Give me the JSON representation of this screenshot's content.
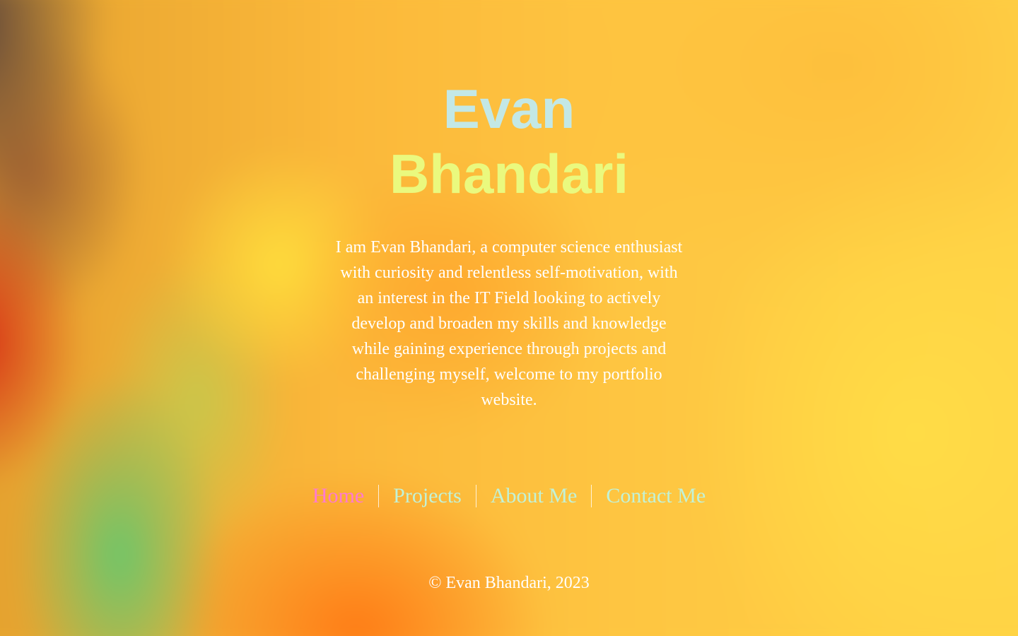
{
  "header": {
    "first_name": "Evan",
    "last_name": "Bhandari"
  },
  "intro": {
    "text": "I am Evan Bhandari, a computer science enthusiast with curiosity and relentless self-motivation, with an interest in the IT Field looking to actively develop and broaden my skills and knowledge while gaining experience through projects and challenging myself, welcome to my portfolio website."
  },
  "nav": {
    "items": [
      {
        "label": "Home",
        "active": true
      },
      {
        "label": "Projects"
      },
      {
        "label": "About Me"
      },
      {
        "label": "Contact Me"
      }
    ]
  },
  "footer": {
    "text": "© Evan Bhandari, 2023"
  },
  "colors": {
    "first_name": "#c3e8e6",
    "last_name": "#eaf97e",
    "nav_active": "#ff7ad0",
    "nav_link": "#c2f2d6",
    "body_text": "#ffffff"
  }
}
